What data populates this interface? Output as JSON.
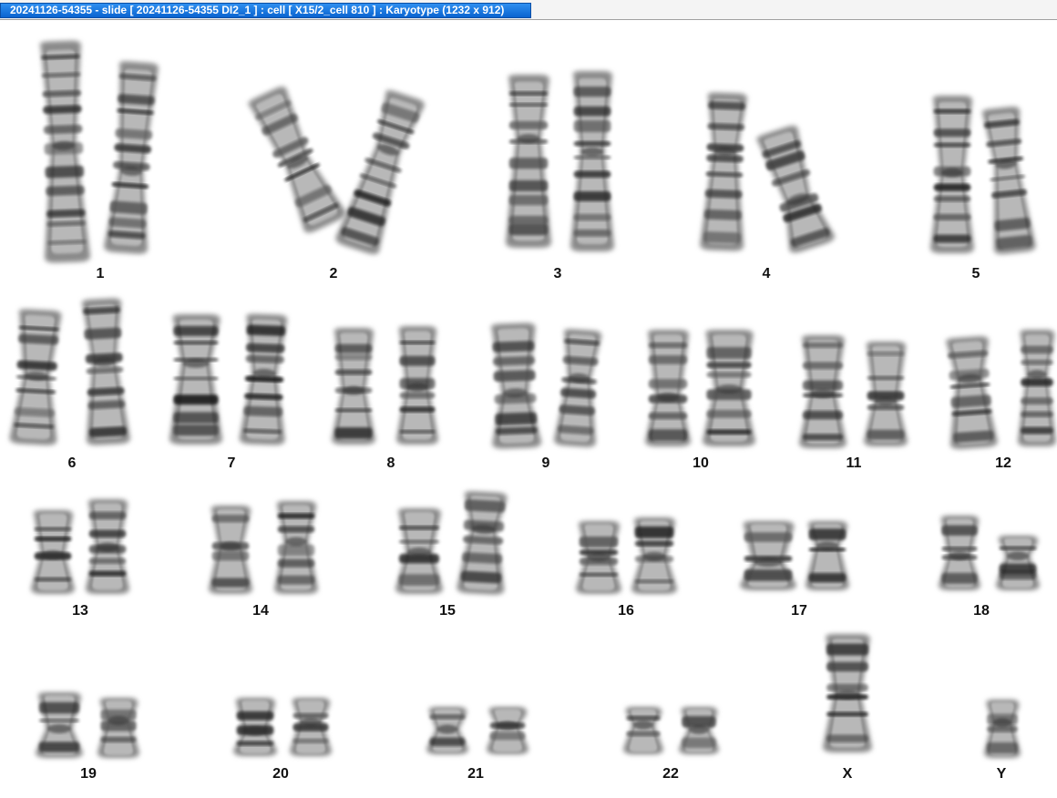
{
  "window": {
    "title": "20241126-54355 - slide [ 20241126-54355 DI2_1 ] : cell [ X15/2_cell 810 ] : Karyotype  (1232 x 912)"
  },
  "karyotype": {
    "labels": [
      "1",
      "2",
      "3",
      "4",
      "5",
      "6",
      "7",
      "8",
      "9",
      "10",
      "11",
      "12",
      "13",
      "14",
      "15",
      "16",
      "17",
      "18",
      "19",
      "20",
      "21",
      "22",
      "X",
      "Y"
    ]
  }
}
